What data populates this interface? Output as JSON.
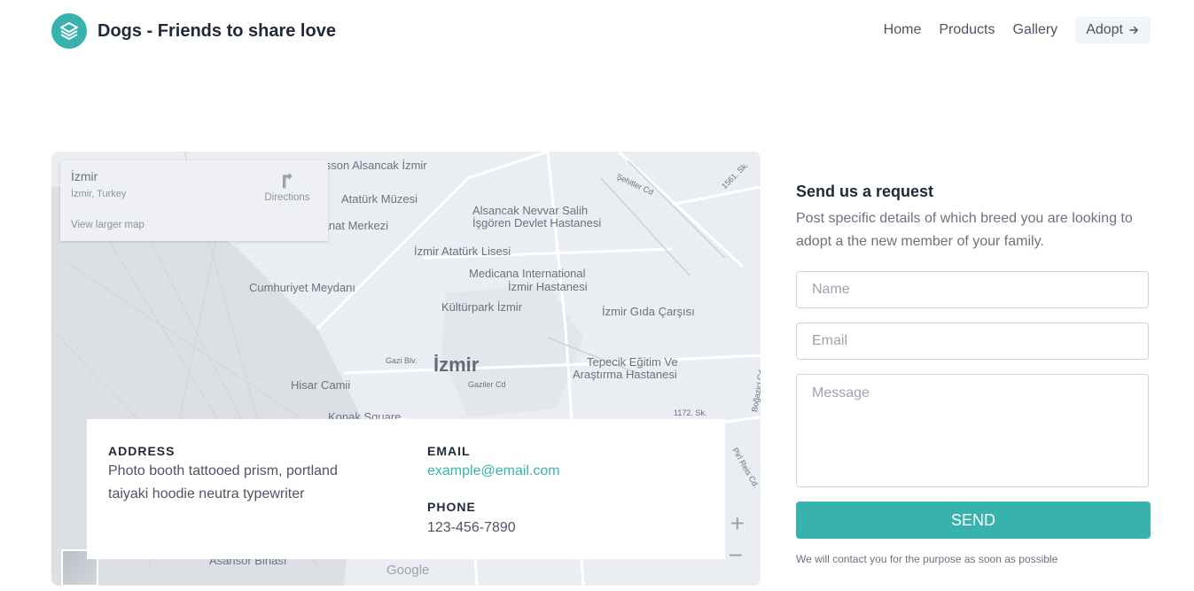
{
  "header": {
    "brand": "Dogs - Friends to share love",
    "nav": [
      "Home",
      "Products",
      "Gallery"
    ],
    "adopt_label": "Adopt",
    "logo_icon": "layers-icon",
    "adopt_icon": "arrow-right-icon"
  },
  "map": {
    "place_title": "İzmir",
    "place_subtitle": "İzmir, Turkey",
    "directions_label": "Directions",
    "larger_map_label": "View larger map",
    "city_label": "İzmir",
    "google_label": "Google",
    "labels": [
      "Radisson Alsancak İzmir",
      "Atatürk Müzesi",
      "Alsancak Nevvar Salih",
      "İşgören Devlet Hastanesi",
      "İzmir Atatürk Lisesi",
      "Medicana International",
      "İzmir Hastanesi",
      "Kültürpark İzmir",
      "İzmir Gıda Çarşısı",
      "Cumhuriyet Meydanı",
      "Tepecik Eğitim Ve",
      "Araştırma Hastanesi",
      "Hisar Camii",
      "Konak Square",
      "Asansör Binası",
      "Gazi Blv.",
      "Gaziler Cd",
      "Şehitler Cd",
      "1561. Sk.",
      "1172. Sk.",
      "Pirî Reis Cd.",
      "Boğaziçi Cd.",
      "Sanat Merkezi"
    ]
  },
  "info": {
    "address_label": "ADDRESS",
    "address_text": "Photo booth tattooed prism, portland taiyaki hoodie neutra typewriter",
    "email_label": "EMAIL",
    "email_value": "example@email.com",
    "phone_label": "PHONE",
    "phone_value": "123-456-7890"
  },
  "form": {
    "title": "Send us a request",
    "description": "Post specific details of which breed you are looking to adopt a the new member of your family.",
    "name_placeholder": "Name",
    "email_placeholder": "Email",
    "message_placeholder": "Message",
    "send_label": "SEND",
    "note": "We will contact you for the purpose as soon as possible"
  },
  "colors": {
    "accent": "#38b2ac",
    "map_bg": "#eaedf1"
  }
}
